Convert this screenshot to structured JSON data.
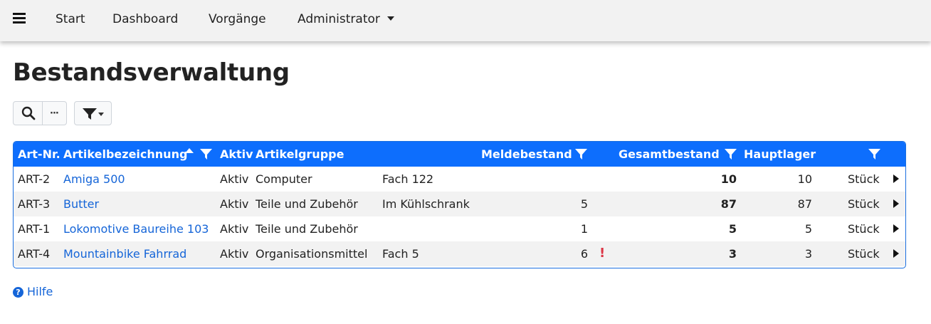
{
  "nav": {
    "items": [
      "Start",
      "Dashboard",
      "Vorgänge",
      "Administrator"
    ]
  },
  "page": {
    "title": "Bestandsverwaltung"
  },
  "toolbar": {
    "more_label": "···"
  },
  "table": {
    "columns": [
      "Art-Nr.",
      "Artikelbezeichnung",
      "Aktiv",
      "Artikelgruppe",
      "Meldebestand",
      "Gesamtbestand",
      "Hauptlager"
    ],
    "rows": [
      {
        "art_nr": "ART-2",
        "name": "Amiga 500",
        "aktiv": "Aktiv",
        "gruppe": "Computer",
        "lagerort": "Fach 122",
        "meldebestand": "",
        "warn": "",
        "gesamt": "10",
        "haupt": "10",
        "einheit": "Stück"
      },
      {
        "art_nr": "ART-3",
        "name": "Butter",
        "aktiv": "Aktiv",
        "gruppe": "Teile und Zubehör",
        "lagerort": "Im Kühlschrank",
        "meldebestand": "5",
        "warn": "",
        "gesamt": "87",
        "haupt": "87",
        "einheit": "Stück"
      },
      {
        "art_nr": "ART-1",
        "name": "Lokomotive Baureihe 103",
        "aktiv": "Aktiv",
        "gruppe": "Teile und Zubehör",
        "lagerort": "",
        "meldebestand": "1",
        "warn": "",
        "gesamt": "5",
        "haupt": "5",
        "einheit": "Stück"
      },
      {
        "art_nr": "ART-4",
        "name": "Mountainbike Fahrrad",
        "aktiv": "Aktiv",
        "gruppe": "Organisationsmittel",
        "lagerort": "Fach 5",
        "meldebestand": "6",
        "warn": "!",
        "gesamt": "3",
        "haupt": "3",
        "einheit": "Stück"
      }
    ]
  },
  "footer": {
    "help_label": "Hilfe",
    "help_icon": "?"
  },
  "icons": {
    "menu": "hamburger-icon",
    "search": "search-icon",
    "more": "more-icon",
    "filter": "filter-icon",
    "sort": "sort-asc-icon",
    "row_action": "caret-right-icon",
    "help": "help-circle-icon"
  },
  "colors": {
    "header_bg": "#0d6efd",
    "link": "#1565d8",
    "warning": "#dc3545",
    "navbar_bg": "#f2f2f2"
  }
}
